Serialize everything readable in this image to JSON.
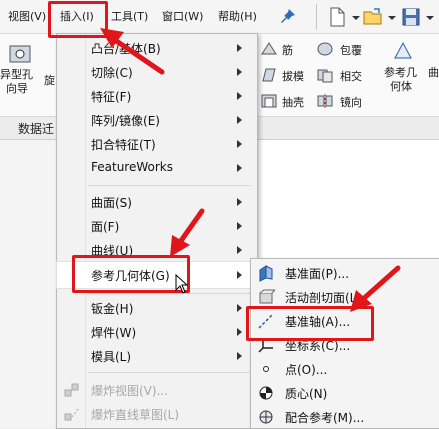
{
  "menubar": {
    "items": [
      "视图(V)",
      "插入(I)",
      "工具(T)",
      "窗口(W)",
      "帮助(H)"
    ]
  },
  "ribbon": {
    "left_label": "异型孔\n向导",
    "left_label_top": "异型孔",
    "left_label_bottom": "向导",
    "spin": "旋",
    "tools": [
      "筋",
      "包覆",
      "拔模",
      "相交",
      "抽壳",
      "镜向"
    ],
    "ref_geo_line1": "参考几",
    "ref_geo_line2": "何体",
    "curve_short": "曲"
  },
  "tabs": {
    "data": "数据迁"
  },
  "insert_menu": {
    "items": [
      {
        "label": "凸台/基体(B)",
        "arrow": true,
        "disabled": false
      },
      {
        "label": "切除(C)",
        "arrow": true,
        "disabled": false
      },
      {
        "label": "特征(F)",
        "arrow": true,
        "disabled": false
      },
      {
        "label": "阵列/镜像(E)",
        "arrow": true,
        "disabled": false
      },
      {
        "label": "扣合特征(T)",
        "arrow": true,
        "disabled": false
      },
      {
        "label": "FeatureWorks",
        "arrow": true,
        "disabled": false
      },
      {
        "label": "曲面(S)",
        "arrow": true,
        "disabled": false
      },
      {
        "label": "面(F)",
        "arrow": true,
        "disabled": false
      },
      {
        "label": "曲线(U)",
        "arrow": true,
        "disabled": false
      },
      {
        "label": "参考几何体(G)",
        "arrow": true,
        "disabled": false
      },
      {
        "label": "钣金(H)",
        "arrow": true,
        "disabled": false
      },
      {
        "label": "焊件(W)",
        "arrow": true,
        "disabled": false
      },
      {
        "label": "模具(L)",
        "arrow": true,
        "disabled": false
      },
      {
        "label": "爆炸视图(V)...",
        "arrow": false,
        "disabled": true
      },
      {
        "label": "爆炸直线草图(L)",
        "arrow": false,
        "disabled": true
      }
    ]
  },
  "ref_geometry_submenu": {
    "items": [
      {
        "label": "基准面(P)...",
        "icon": "plane-icon"
      },
      {
        "label": "活动剖切面(L)",
        "icon": "section-plane-icon"
      },
      {
        "label": "基准轴(A)...",
        "icon": "axis-icon"
      },
      {
        "label": "坐标系(C)...",
        "icon": "coordinate-system-icon"
      },
      {
        "label": "点(O)...",
        "icon": "point-icon"
      },
      {
        "label": "质心(N)",
        "icon": "center-of-mass-icon"
      },
      {
        "label": "配合参考(M)...",
        "icon": "mate-reference-icon"
      }
    ]
  },
  "colors": {
    "annotation_red": "#e0161b"
  }
}
